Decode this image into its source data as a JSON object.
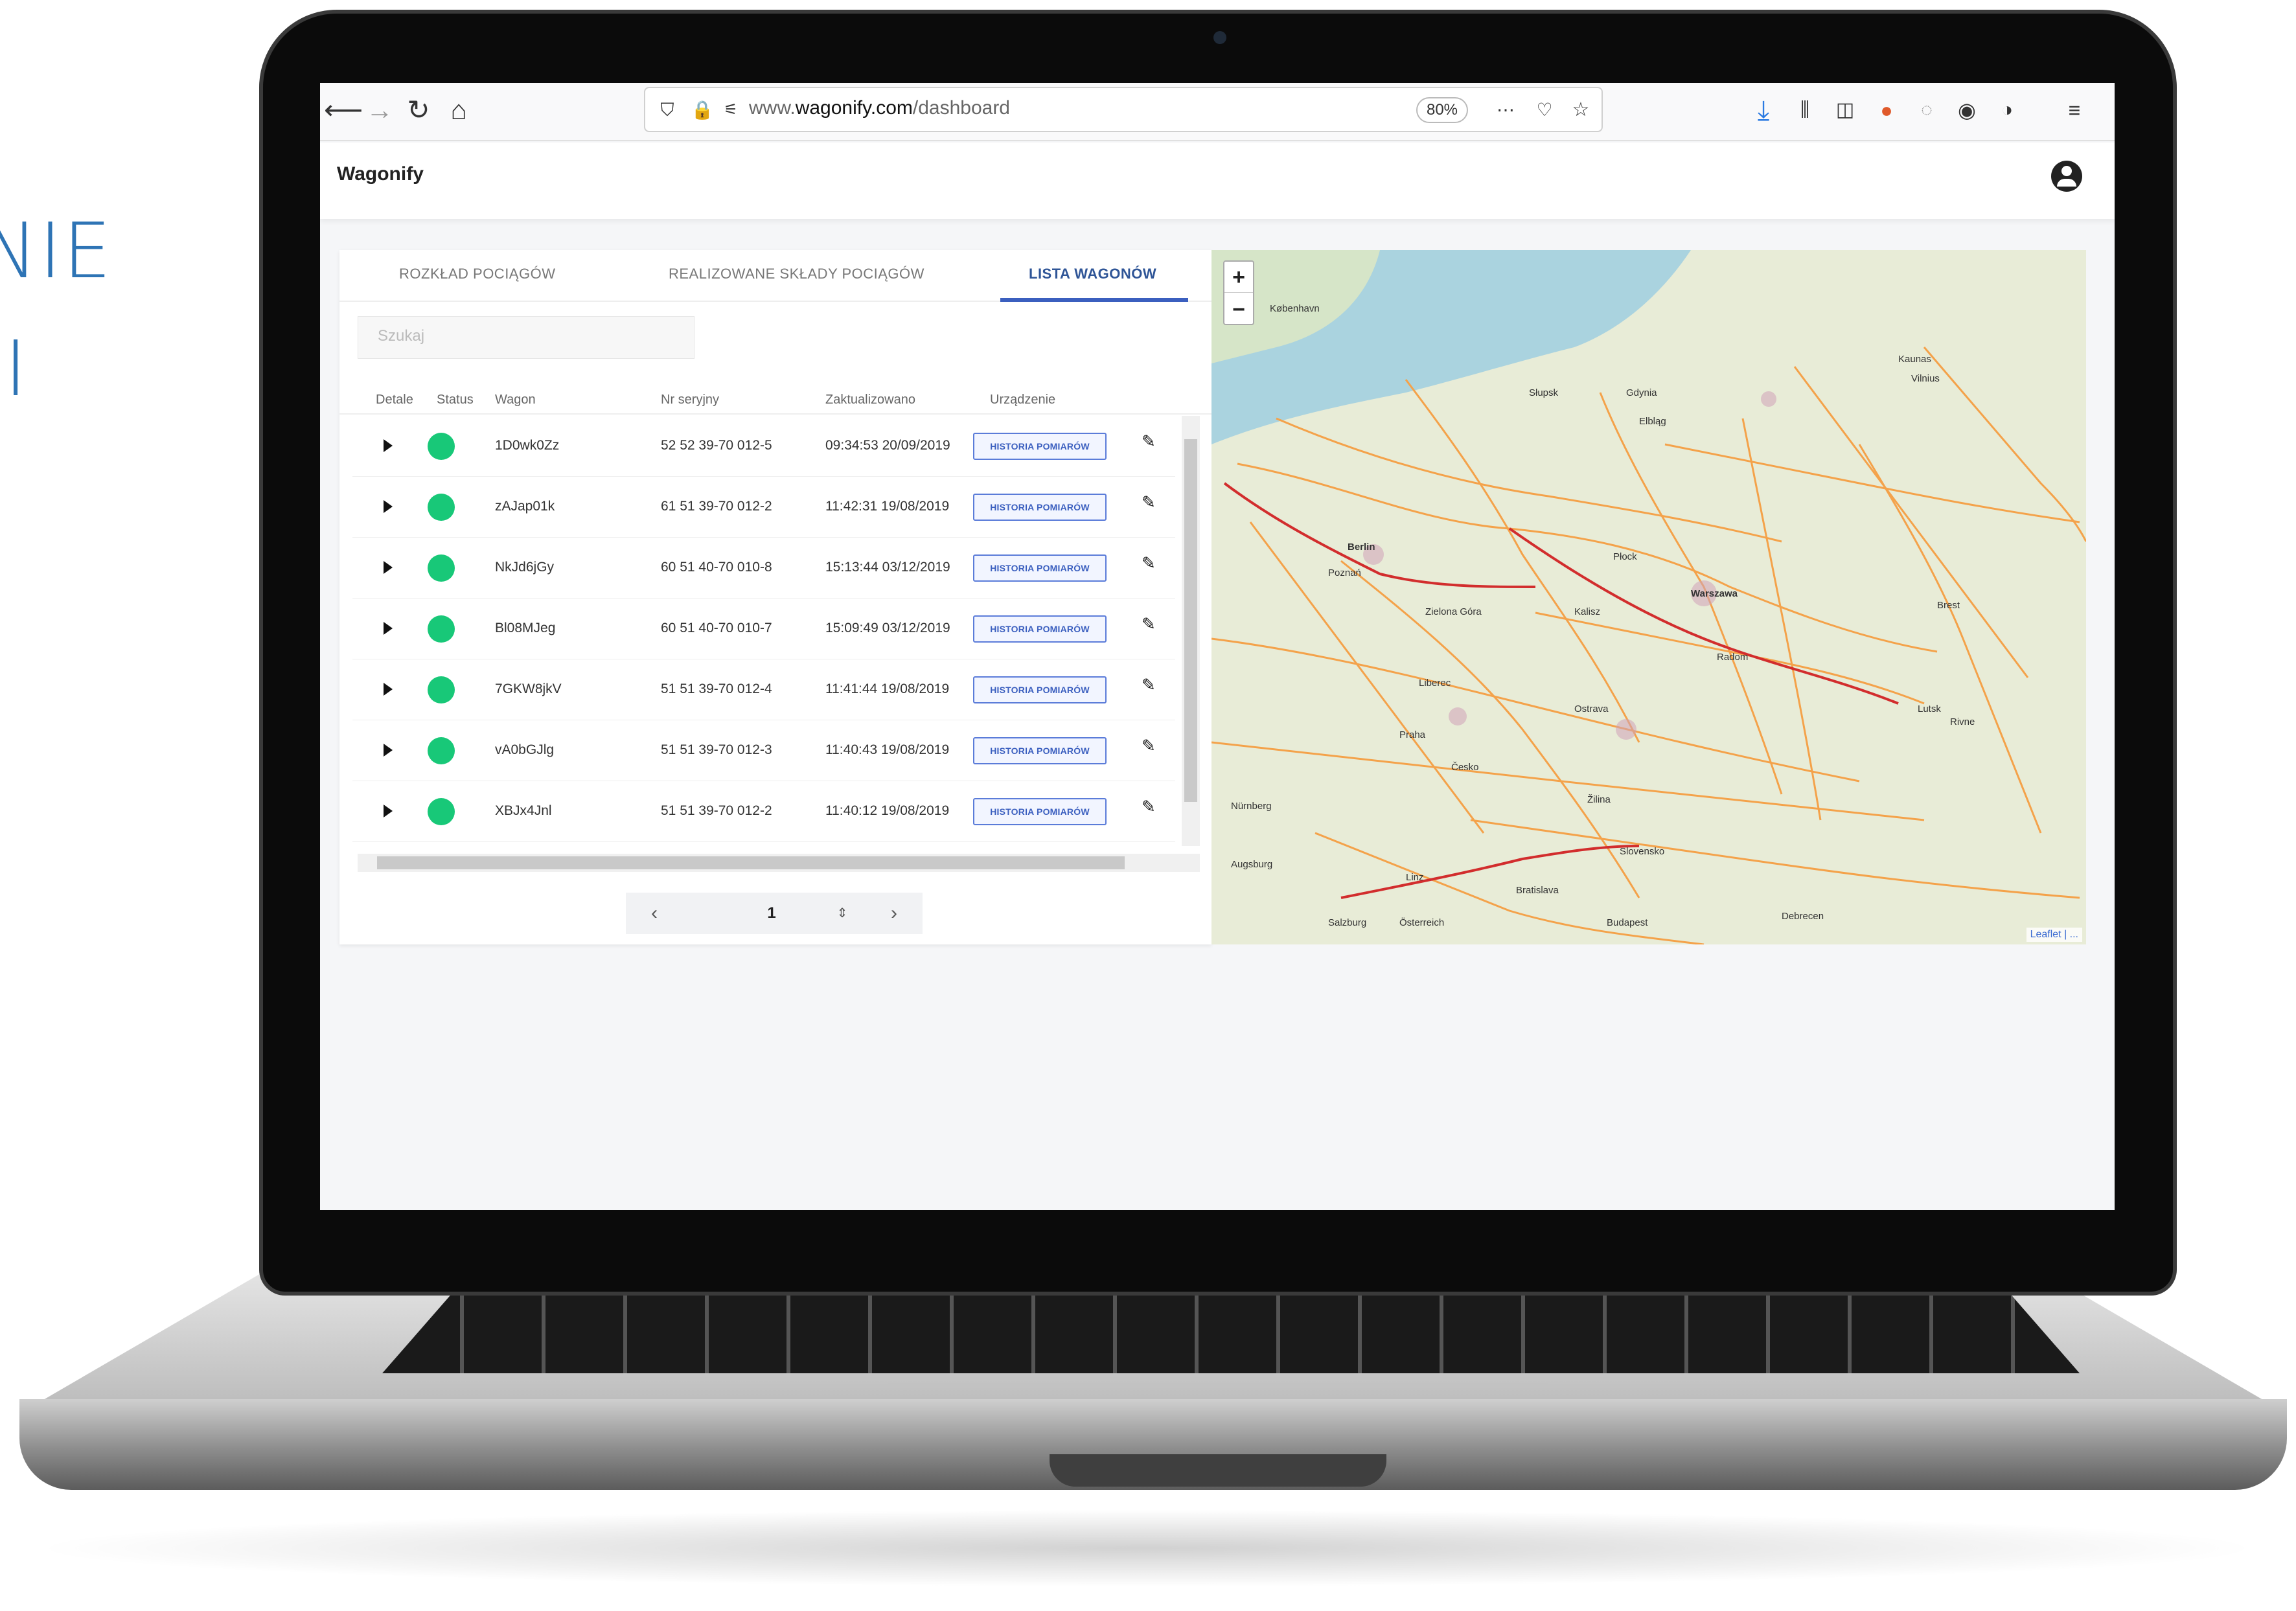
{
  "slide": {
    "line1": "NIE",
    "line2": "JI"
  },
  "browser": {
    "url_prefix": "www.",
    "url_domain": "wagonify.com",
    "url_path": "/dashboard",
    "zoom": "80%"
  },
  "app": {
    "brand": "Wagonify"
  },
  "tabs": [
    {
      "label": "ROZKŁAD POCIĄGÓW"
    },
    {
      "label": "REALIZOWANE SKŁADY POCIĄGÓW"
    },
    {
      "label": "LISTA WAGONÓW"
    }
  ],
  "search": {
    "placeholder": "Szukaj"
  },
  "table": {
    "headers": [
      "Detale",
      "Status",
      "Wagon",
      "Nr seryjny",
      "Zaktualizowano",
      "Urządzenie"
    ],
    "rows": [
      {
        "wagon": "1D0wk0Zz",
        "serial": "52 52 39-70 012-5",
        "updated": "09:34:53 20/09/2019",
        "device": "HISTORIA POMIARÓW"
      },
      {
        "wagon": "zAJap01k",
        "serial": "61 51 39-70 012-2",
        "updated": "11:42:31 19/08/2019",
        "device": "HISTORIA POMIARÓW"
      },
      {
        "wagon": "NkJd6jGy",
        "serial": "60 51 40-70 010-8",
        "updated": "15:13:44 03/12/2019",
        "device": "HISTORIA POMIARÓW"
      },
      {
        "wagon": "Bl08MJeg",
        "serial": "60 51 40-70 010-7",
        "updated": "15:09:49 03/12/2019",
        "device": "HISTORIA POMIARÓW"
      },
      {
        "wagon": "7GKW8jkV",
        "serial": "51 51 39-70 012-4",
        "updated": "11:41:44 19/08/2019",
        "device": "HISTORIA POMIARÓW"
      },
      {
        "wagon": "vA0bGJlg",
        "serial": "51 51 39-70 012-3",
        "updated": "11:40:43 19/08/2019",
        "device": "HISTORIA POMIARÓW"
      },
      {
        "wagon": "XBJx4Jnl",
        "serial": "51 51 39-70 012-2",
        "updated": "11:40:12 19/08/2019",
        "device": "HISTORIA POMIARÓW"
      }
    ]
  },
  "pagination": {
    "prev": "‹",
    "page": "1",
    "next": "›"
  },
  "map": {
    "zoom_in": "+",
    "zoom_out": "−",
    "attribution": "Leaflet | ...",
    "labels": [
      "København",
      "Słupsk",
      "Gdynia",
      "Elbląg",
      "Kaunas",
      "Vilnius",
      "Berlin",
      "Poznań",
      "Płock",
      "Warszawa",
      "Kalisz",
      "Radom",
      "Zielona Góra",
      "Liberec",
      "Praha",
      "Česko",
      "Ostrava",
      "Žilina",
      "Slovensko",
      "Bratislava",
      "Linz",
      "Österreich",
      "Salzburg",
      "Augsburg",
      "Nürnberg",
      "Budapest",
      "Debrecen",
      "Lutsk",
      "Rivne",
      "Brest"
    ]
  }
}
